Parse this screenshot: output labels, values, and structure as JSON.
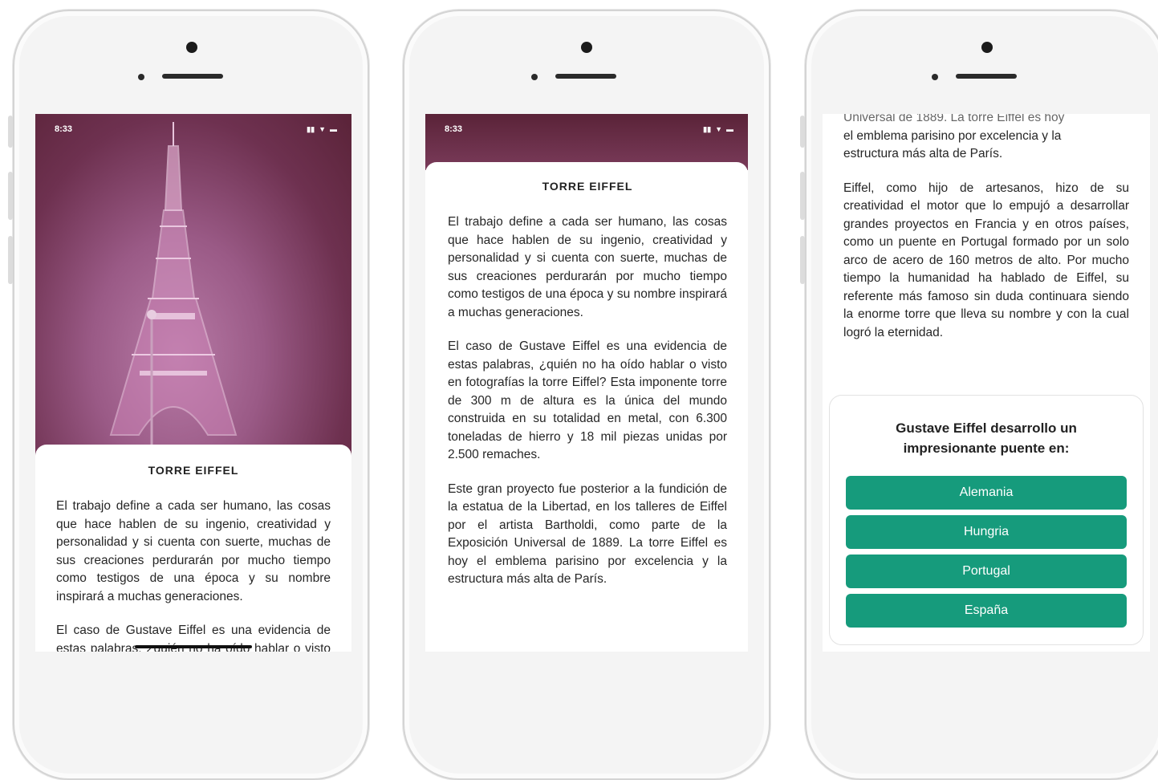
{
  "statusbar": {
    "time": "8:33",
    "signal_icon": "signal-bars-icon",
    "wifi_icon": "wifi-icon",
    "battery_icon": "battery-icon"
  },
  "article": {
    "title": "TORRE EIFFEL",
    "paragraphs": [
      "El trabajo define a cada ser humano, las cosas que hace hablen de su ingenio, creatividad y personalidad y si cuenta con suerte, muchas de sus creaciones perdurarán por mucho tiempo como testigos de una época y su nombre inspirará a muchas generaciones.",
      "El caso de Gustave Eiffel es una evidencia de estas palabras, ¿quién no ha oído hablar o visto en fotografías la torre Eiffel? Esta imponente torre de 300 m de altura es la única del mundo construida en su totalidad en metal, con 6.300 toneladas de hierro y 18 mil piezas unidas por 2.500 remaches.",
      "Este gran proyecto fue posterior a la fundición de la estatua de la Libertad, en los talleres de Eiffel por el artista Bartholdi, como parte de la Exposición Universal de 1889. La torre Eiffel es hoy el emblema parisino por excelencia y la estructura más alta de París.",
      "Eiffel, como hijo de artesanos, hizo de su creatividad el motor que lo empujó a desarrollar grandes proyectos en Francia y en otros países, como un puente en Portugal formado por un solo arco de acero de 160 metros de alto. Por mucho tiempo la humanidad ha hablado de Eiffel, su referente más famoso sin duda continuara siendo la enorme torre que lleva su nombre y con la cual logró la eternidad."
    ],
    "partial_top_line": "Universal de 1889. La torre Eiffel es hoy",
    "partial_emblem": "el emblema parisino por excelencia y la",
    "partial_end": "estructura más alta de París."
  },
  "quiz": {
    "question": "Gustave Eiffel desarrollo un impresionante puente en:",
    "options": [
      "Alemania",
      "Hungria",
      "Portugal",
      "España"
    ],
    "accent_color": "#169b7c"
  }
}
